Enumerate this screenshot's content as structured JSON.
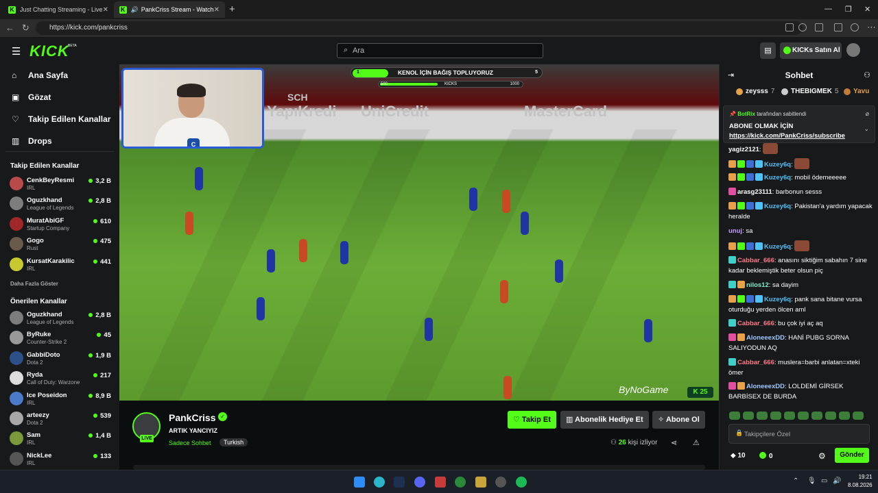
{
  "browser": {
    "tabs": [
      {
        "title": "Just Chatting Streaming - Live Stre"
      },
      {
        "title": "PankCriss Stream - Watch Live"
      }
    ],
    "url": "https://kick.com/pankcriss"
  },
  "header": {
    "logo": "KICK",
    "beta": "BETA",
    "search_placeholder": "Ara",
    "kicks_button": "KICKs Satın Al"
  },
  "sidebar": {
    "nav": [
      {
        "label": "Ana Sayfa",
        "icon": "home-icon"
      },
      {
        "label": "Gözat",
        "icon": "browse-icon"
      },
      {
        "label": "Takip Edilen Kanallar",
        "icon": "heart-icon"
      },
      {
        "label": "Drops",
        "icon": "drops-icon"
      }
    ],
    "followed_title": "Takip Edilen Kanallar",
    "followed": [
      {
        "name": "CenkBeyResmi",
        "category": "IRL",
        "viewers": "3,2 B",
        "color": "#b84a4a"
      },
      {
        "name": "Oguzkhand",
        "category": "League of Legends",
        "viewers": "2,8 B",
        "color": "#7d7d7d"
      },
      {
        "name": "MuratAbiGF",
        "category": "Startup Company",
        "viewers": "610",
        "color": "#a02828"
      },
      {
        "name": "Gogo",
        "category": "Rust",
        "viewers": "475",
        "color": "#6a5a4a"
      },
      {
        "name": "KursatKarakilic",
        "category": "IRL",
        "viewers": "441",
        "color": "#c8c830"
      }
    ],
    "show_more": "Daha Fazla Göster",
    "suggested_title": "Önerilen Kanallar",
    "suggested": [
      {
        "name": "Oguzkhand",
        "category": "League of Legends",
        "viewers": "2,8 B",
        "color": "#7d7d7d"
      },
      {
        "name": "ByRuke",
        "category": "Counter-Strike 2",
        "viewers": "45",
        "color": "#999999"
      },
      {
        "name": "GabbiDoto",
        "category": "Dota 2",
        "viewers": "1,9 B",
        "color": "#2d4f8a"
      },
      {
        "name": "Ryda",
        "category": "Call of Duty: Warzone",
        "viewers": "217",
        "color": "#dddddd"
      },
      {
        "name": "Ice Poseidon",
        "category": "IRL",
        "viewers": "8,9 B",
        "color": "#4a7ac8"
      },
      {
        "name": "arteezy",
        "category": "Dota 2",
        "viewers": "539",
        "color": "#a8a8a8"
      },
      {
        "name": "Sam",
        "category": "IRL",
        "viewers": "1,4 B",
        "color": "#7a9a3a"
      },
      {
        "name": "NickLee",
        "category": "IRL",
        "viewers": "133",
        "color": "#555555"
      }
    ]
  },
  "video": {
    "banner_title": "KENOL İÇİN BAĞIŞ TOPLUYORUZ",
    "banner_left": "1",
    "banner_right": "5",
    "bar_left": "500",
    "bar_mid": "KICKS",
    "bar_right": "1000",
    "ads": [
      "SCH",
      "YapıKredi",
      "UniCredit",
      "MasterCard"
    ],
    "watermark": "ByNoGame",
    "badge": "25"
  },
  "stream": {
    "name": "PankCriss",
    "title": "ARTIK YANCIYIZ",
    "category": "Sadece Sohbet",
    "tag": "Turkish",
    "live": "LIVE",
    "follow": "Takip Et",
    "gift": "Abonelik Hediye Et",
    "subscribe": "Abone Ol",
    "viewers": "26",
    "viewers_label": "kişi izliyor"
  },
  "chat": {
    "title": "Sohbet",
    "gifters": [
      {
        "name": "zeysss",
        "count": "7"
      },
      {
        "name": "THEBIGMEK",
        "count": "5"
      },
      {
        "name": "Yavu",
        "count": ""
      }
    ],
    "pin_by": "BotRix",
    "pin_by_suffix": "tarafından sabitlendi",
    "pin_heading": "ABONE OLMAK İÇİN",
    "pin_link": "https://kick.com/PankCriss/subscribe",
    "messages": [
      {
        "user": "yagiz2121",
        "text": "",
        "color": "#ffffff",
        "emote": true
      },
      {
        "user": "Kuzey6q",
        "text": "",
        "color": "#4fc3f7",
        "emote": true
      },
      {
        "user": "Kuzey6q",
        "text": "mobil ödemeeeee",
        "color": "#4fc3f7"
      },
      {
        "user": "arasg23111",
        "text": "barbonun sesss",
        "color": "#ffffff"
      },
      {
        "user": "Kuzey6q",
        "text": "Pakistan'a yardım yapacak heralde",
        "color": "#4fc3f7"
      },
      {
        "user": "unuj",
        "text": "sa",
        "color": "#c39cff"
      },
      {
        "user": "Kuzey6q",
        "text": "",
        "color": "#4fc3f7",
        "emote": true
      },
      {
        "user": "Cabbar_666",
        "text": "anasını siktiğim sabahın 7 sine kadar beklemiştik beter olsun piç",
        "color": "#ff7a8a"
      },
      {
        "user": "nilos12",
        "text": "sa dayim",
        "color": "#7ef0c9"
      },
      {
        "user": "Kuzey6q",
        "text": "pank sana bitane vursa oturduğu yerden ölcen aml",
        "color": "#4fc3f7"
      },
      {
        "user": "Cabbar_666",
        "text": "bu çok iyi aç aq",
        "color": "#ff7a8a"
      },
      {
        "user": "AloneeexDD",
        "text": "HANİ PUBG SORNA SALIYODUN AQ",
        "color": "#9fc8ff"
      },
      {
        "user": "Cabbar_666",
        "text": "muslera=barbi anlatan=xteki ömer",
        "color": "#ff7a8a"
      },
      {
        "user": "AloneeexDD",
        "text": "LOLDEMİ GİRSEK BARBİSEX DE BURDA",
        "color": "#9fc8ff"
      }
    ],
    "input_placeholder": "Takipçilere Özel",
    "count1": "10",
    "count2": "0",
    "send": "Gönder"
  },
  "taskbar": {
    "time": "19:21",
    "date": "8.08.2026"
  }
}
